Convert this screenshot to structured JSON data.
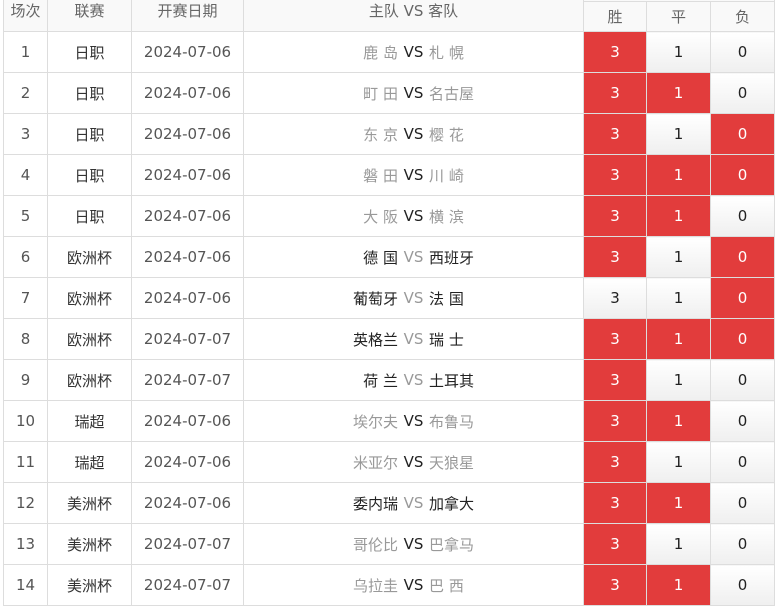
{
  "header": {
    "col_idx": "场次",
    "col_league": "联赛",
    "col_date": "开赛日期",
    "col_match": "主队 VS 客队",
    "col_win": "胜",
    "col_draw": "平",
    "col_lose": "负"
  },
  "colors": {
    "selected": "#e23c3c",
    "border": "#dddddd"
  },
  "rows": [
    {
      "idx": "1",
      "league": "日职",
      "date": "2024-07-06",
      "home": "鹿 岛",
      "vs": "VS",
      "away": "札 幌",
      "home_dark": false,
      "vs_dark": true,
      "away_dark": false,
      "win": "3",
      "draw": "1",
      "lose": "0",
      "win_sel": true,
      "draw_sel": false,
      "lose_sel": false
    },
    {
      "idx": "2",
      "league": "日职",
      "date": "2024-07-06",
      "home": "町 田",
      "vs": "VS",
      "away": "名古屋",
      "home_dark": false,
      "vs_dark": true,
      "away_dark": false,
      "win": "3",
      "draw": "1",
      "lose": "0",
      "win_sel": true,
      "draw_sel": true,
      "lose_sel": false
    },
    {
      "idx": "3",
      "league": "日职",
      "date": "2024-07-06",
      "home": "东 京",
      "vs": "VS",
      "away": "樱 花",
      "home_dark": false,
      "vs_dark": true,
      "away_dark": false,
      "win": "3",
      "draw": "1",
      "lose": "0",
      "win_sel": true,
      "draw_sel": false,
      "lose_sel": true
    },
    {
      "idx": "4",
      "league": "日职",
      "date": "2024-07-06",
      "home": "磐 田",
      "vs": "VS",
      "away": "川 崎",
      "home_dark": false,
      "vs_dark": true,
      "away_dark": false,
      "win": "3",
      "draw": "1",
      "lose": "0",
      "win_sel": true,
      "draw_sel": true,
      "lose_sel": true
    },
    {
      "idx": "5",
      "league": "日职",
      "date": "2024-07-06",
      "home": "大 阪",
      "vs": "VS",
      "away": "横 滨",
      "home_dark": false,
      "vs_dark": true,
      "away_dark": false,
      "win": "3",
      "draw": "1",
      "lose": "0",
      "win_sel": true,
      "draw_sel": true,
      "lose_sel": false
    },
    {
      "idx": "6",
      "league": "欧洲杯",
      "date": "2024-07-06",
      "home": "德 国",
      "vs": "VS",
      "away": "西班牙",
      "home_dark": true,
      "vs_dark": false,
      "away_dark": true,
      "win": "3",
      "draw": "1",
      "lose": "0",
      "win_sel": true,
      "draw_sel": false,
      "lose_sel": true
    },
    {
      "idx": "7",
      "league": "欧洲杯",
      "date": "2024-07-06",
      "home": "葡萄牙",
      "vs": "VS",
      "away": "法 国",
      "home_dark": true,
      "vs_dark": false,
      "away_dark": true,
      "win": "3",
      "draw": "1",
      "lose": "0",
      "win_sel": false,
      "draw_sel": false,
      "lose_sel": true
    },
    {
      "idx": "8",
      "league": "欧洲杯",
      "date": "2024-07-07",
      "home": "英格兰",
      "vs": "VS",
      "away": "瑞 士",
      "home_dark": true,
      "vs_dark": false,
      "away_dark": true,
      "win": "3",
      "draw": "1",
      "lose": "0",
      "win_sel": true,
      "draw_sel": true,
      "lose_sel": true
    },
    {
      "idx": "9",
      "league": "欧洲杯",
      "date": "2024-07-07",
      "home": "荷 兰",
      "vs": "VS",
      "away": "土耳其",
      "home_dark": true,
      "vs_dark": false,
      "away_dark": true,
      "win": "3",
      "draw": "1",
      "lose": "0",
      "win_sel": true,
      "draw_sel": false,
      "lose_sel": false
    },
    {
      "idx": "10",
      "league": "瑞超",
      "date": "2024-07-06",
      "home": "埃尔夫",
      "vs": "VS",
      "away": "布鲁马",
      "home_dark": false,
      "vs_dark": true,
      "away_dark": false,
      "win": "3",
      "draw": "1",
      "lose": "0",
      "win_sel": true,
      "draw_sel": true,
      "lose_sel": false
    },
    {
      "idx": "11",
      "league": "瑞超",
      "date": "2024-07-06",
      "home": "米亚尔",
      "vs": "VS",
      "away": "天狼星",
      "home_dark": false,
      "vs_dark": true,
      "away_dark": false,
      "win": "3",
      "draw": "1",
      "lose": "0",
      "win_sel": true,
      "draw_sel": false,
      "lose_sel": false
    },
    {
      "idx": "12",
      "league": "美洲杯",
      "date": "2024-07-06",
      "home": "委内瑞",
      "vs": "VS",
      "away": "加拿大",
      "home_dark": true,
      "vs_dark": false,
      "away_dark": true,
      "win": "3",
      "draw": "1",
      "lose": "0",
      "win_sel": true,
      "draw_sel": true,
      "lose_sel": false
    },
    {
      "idx": "13",
      "league": "美洲杯",
      "date": "2024-07-07",
      "home": "哥伦比",
      "vs": "VS",
      "away": "巴拿马",
      "home_dark": false,
      "vs_dark": true,
      "away_dark": false,
      "win": "3",
      "draw": "1",
      "lose": "0",
      "win_sel": true,
      "draw_sel": false,
      "lose_sel": false
    },
    {
      "idx": "14",
      "league": "美洲杯",
      "date": "2024-07-07",
      "home": "乌拉圭",
      "vs": "VS",
      "away": "巴 西",
      "home_dark": false,
      "vs_dark": true,
      "away_dark": false,
      "win": "3",
      "draw": "1",
      "lose": "0",
      "win_sel": true,
      "draw_sel": true,
      "lose_sel": false
    }
  ]
}
